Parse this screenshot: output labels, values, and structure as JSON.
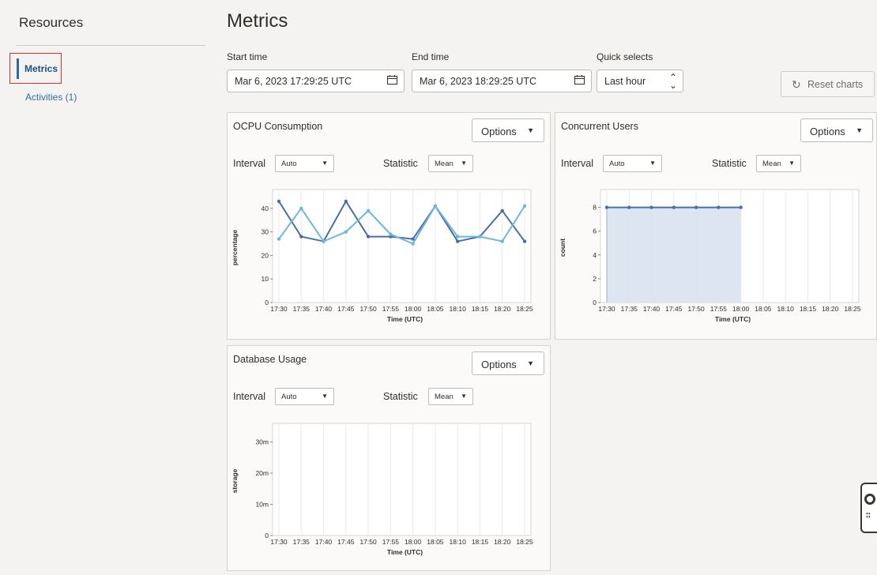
{
  "sidebar": {
    "title": "Resources",
    "items": [
      {
        "label": "Metrics",
        "selected": true
      },
      {
        "label": "Activities (1)",
        "selected": false
      }
    ]
  },
  "main": {
    "title": "Metrics",
    "start_time": {
      "label": "Start time",
      "value": "Mar 6, 2023 17:29:25 UTC"
    },
    "end_time": {
      "label": "End time",
      "value": "Mar 6, 2023 18:29:25 UTC"
    },
    "quick_selects": {
      "label": "Quick selects",
      "value": "Last hour"
    },
    "reset_label": "Reset charts"
  },
  "panels": [
    {
      "title": "OCPU Consumption",
      "options_label": "Options",
      "interval_label": "Interval",
      "interval_value": "Auto",
      "statistic_label": "Statistic",
      "statistic_value": "Mean"
    },
    {
      "title": "Concurrent Users",
      "options_label": "Options",
      "interval_label": "Interval",
      "interval_value": "Auto",
      "statistic_label": "Statistic",
      "statistic_value": "Mean"
    },
    {
      "title": "Database Usage",
      "options_label": "Options",
      "interval_label": "Interval",
      "interval_value": "Auto",
      "statistic_label": "Statistic",
      "statistic_value": "Mean"
    }
  ],
  "colors": {
    "accent": "#2b6aa0",
    "highlight_border": "#e0312b",
    "series_dark": "#4a6fa5",
    "series_light": "#6cb6e0",
    "area_fill": "#d9e2ee"
  },
  "icons": {
    "calendar": "calendar-icon",
    "reset": "refresh-icon",
    "caret": "caret-down-icon",
    "help": "help-lifebuoy-icon"
  },
  "chart_data": [
    {
      "type": "line",
      "title": "",
      "xlabel": "Time (UTC)",
      "ylabel": "percentage",
      "categories": [
        "17:30",
        "17:35",
        "17:40",
        "17:45",
        "17:50",
        "17:55",
        "18:00",
        "18:05",
        "18:10",
        "18:15",
        "18:20",
        "18:25"
      ],
      "ylim": [
        0,
        48
      ],
      "yticks": [
        0,
        10,
        20,
        30,
        40
      ],
      "grid": true,
      "series": [
        {
          "values": [
            43,
            28,
            26,
            43,
            28,
            28,
            27,
            41,
            26,
            28,
            39,
            26
          ]
        },
        {
          "values": [
            27,
            40,
            26,
            30,
            39,
            29,
            25,
            41,
            28,
            28,
            26,
            41
          ]
        }
      ]
    },
    {
      "type": "area",
      "title": "",
      "xlabel": "Time (UTC)",
      "ylabel": "count",
      "categories": [
        "17:30",
        "17:35",
        "17:40",
        "17:45",
        "17:50",
        "17:55",
        "18:00",
        "18:05",
        "18:10",
        "18:15",
        "18:20",
        "18:25"
      ],
      "ylim": [
        0,
        9.5
      ],
      "yticks": [
        0,
        2,
        4,
        6,
        8
      ],
      "grid": true,
      "series": [
        {
          "values": [
            8,
            8,
            8,
            8,
            8,
            8,
            8
          ]
        }
      ]
    },
    {
      "type": "line",
      "title": "",
      "xlabel": "Time (UTC)",
      "ylabel": "storage",
      "categories": [
        "17:30",
        "17:35",
        "17:40",
        "17:45",
        "17:50",
        "17:55",
        "18:00",
        "18:05",
        "18:10",
        "18:15",
        "18:20",
        "18:25"
      ],
      "ylim": [
        0,
        0.036
      ],
      "yticks": [
        0,
        0.01,
        0.02,
        0.03
      ],
      "ytick_labels": [
        "0",
        "10m",
        "20m",
        "30m"
      ],
      "grid": true,
      "series": []
    }
  ]
}
